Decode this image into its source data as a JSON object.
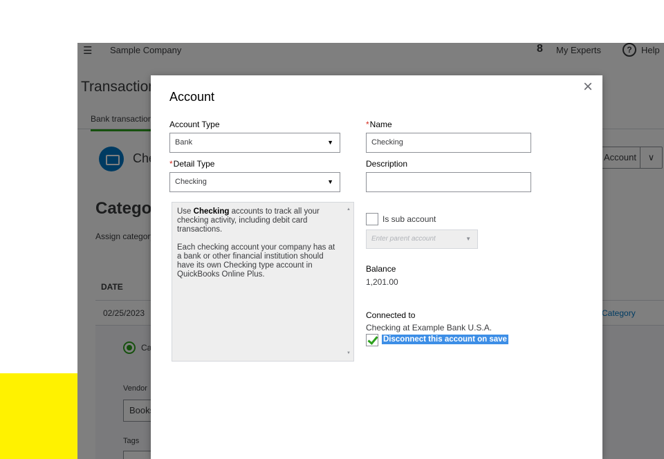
{
  "background": {
    "company": "Sample Company",
    "experts": "My Experts",
    "help": "Help",
    "page_title": "Transactions",
    "tab": "Bank transactions",
    "account_name": "Checking",
    "account_button": "Account",
    "section_title": "Categorize",
    "assign_text": "Assign category",
    "col_date": "DATE",
    "row_date": "02/25/2023",
    "row_category": "Category",
    "radio_label": "Categorize",
    "vendor_label": "Vendor",
    "vendor_value": "Books",
    "tags_label": "Tags"
  },
  "modal": {
    "title": "Account",
    "account_type_label": "Account Type",
    "account_type_value": "Bank",
    "detail_type_label": "Detail Type",
    "detail_type_value": "Checking",
    "name_label": "Name",
    "name_value": "Checking",
    "description_label": "Description",
    "description_value": "",
    "desc_p1_a": "Use ",
    "desc_p1_b": "Checking",
    "desc_p1_c": " accounts to track all your checking activity, including debit card transactions.",
    "desc_p2": "Each checking account your company has at a bank or other financial institution should have its own Checking type account in QuickBooks Online Plus.",
    "sub_account_label": "Is sub account",
    "parent_placeholder": "Enter parent account",
    "balance_label": "Balance",
    "balance_value": "1,201.00",
    "connected_label": "Connected to",
    "connected_value": "Checking at Example Bank U.S.A.",
    "disconnect_label": "Disconnect this account on save"
  },
  "icons": {
    "close": "×",
    "dropdown": "▼",
    "menu": "☰",
    "scroll_up": "▲",
    "scroll_down": "▼"
  }
}
